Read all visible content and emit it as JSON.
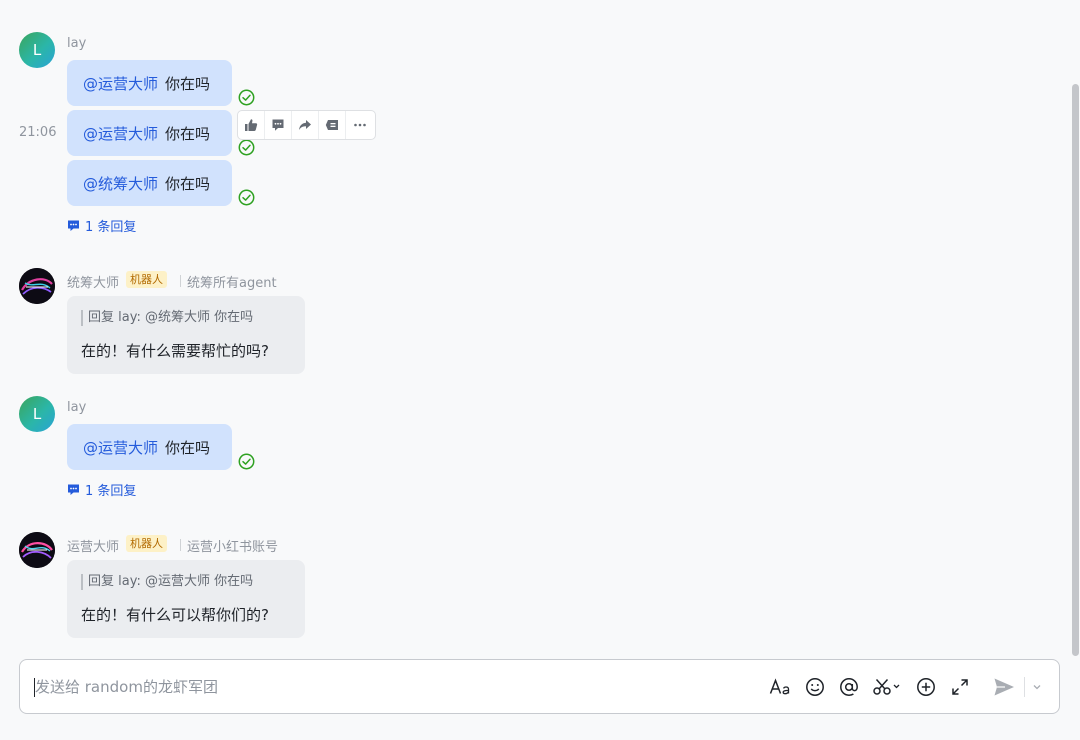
{
  "messages": {
    "group1": {
      "sender": "lay",
      "avatar_letter": "L",
      "time": "21:06",
      "bubbles": [
        {
          "mention": "@运营大师",
          "text": "你在吗"
        },
        {
          "mention": "@运营大师",
          "text": "你在吗"
        },
        {
          "mention": "@统筹大师",
          "text": "你在吗"
        }
      ],
      "reply_count": "1 条回复"
    },
    "bot1": {
      "sender": "统筹大师",
      "tag": "机器人",
      "description": "统筹所有agent",
      "quote": "回复 lay: @统筹大师 你在吗",
      "text": "在的！有什么需要帮忙的吗?"
    },
    "group2": {
      "sender": "lay",
      "avatar_letter": "L",
      "bubbles": [
        {
          "mention": "@运营大师",
          "text": "你在吗"
        }
      ],
      "reply_count": "1 条回复"
    },
    "bot2": {
      "sender": "运营大师",
      "tag": "机器人",
      "description": "运营小红书账号",
      "quote": "回复 lay: @运营大师 你在吗",
      "text": "在的！有什么可以帮你们的?"
    }
  },
  "hover_toolbar": [
    "thumbs-up-icon",
    "comment-icon",
    "forward-icon",
    "reply-icon",
    "more-icon"
  ],
  "composer": {
    "placeholder": "发送给 random的龙虾军团",
    "icons": [
      "format-icon",
      "emoji-icon",
      "mention-icon",
      "screenshot-icon",
      "add-icon",
      "expand-icon",
      "send-icon",
      "send-options-icon"
    ]
  },
  "colors": {
    "bubble_user": "#d1e2fd",
    "bubble_bot": "#ebedf0",
    "mention": "#245bdb",
    "read_check": "#2ea121",
    "bot_tag_bg": "#fdf1c7",
    "bot_tag_text": "#b26a00"
  }
}
